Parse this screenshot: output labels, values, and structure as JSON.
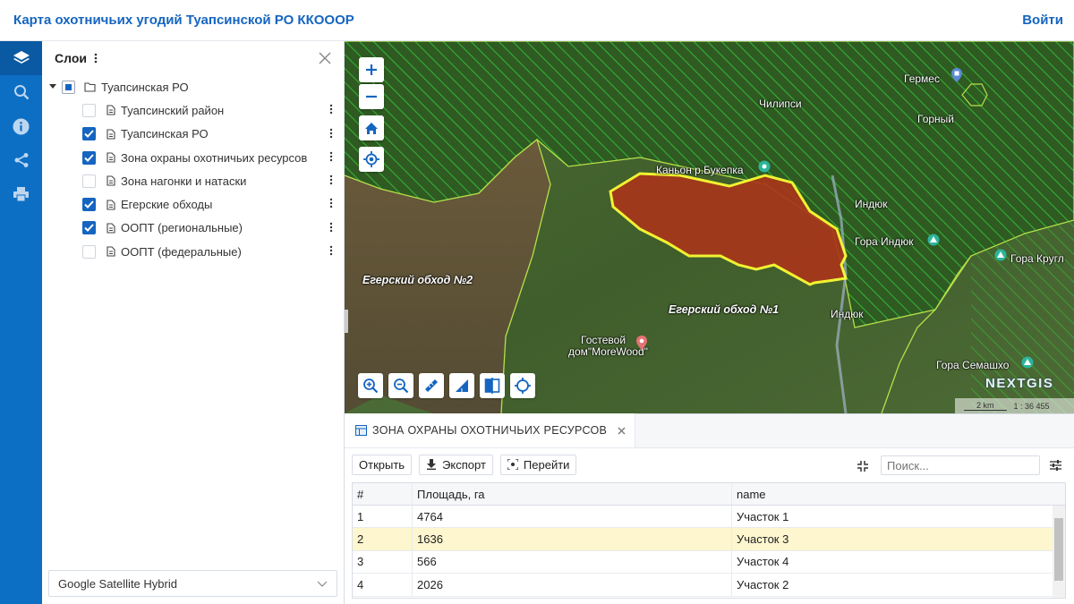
{
  "header": {
    "title": "Карта охотничьих угодий Туапсинской РО ККОООР",
    "login": "Войти"
  },
  "rail": {
    "items": [
      "layers-icon",
      "search-icon",
      "info-icon",
      "share-icon",
      "print-icon"
    ]
  },
  "panel": {
    "title": "Слои",
    "tree_root": "Туапсинская РО",
    "layers": [
      {
        "label": "Туапсинский район",
        "checked": false
      },
      {
        "label": "Туапсинская РО",
        "checked": true
      },
      {
        "label": "Зона охраны охотничьих ресурсов",
        "checked": true
      },
      {
        "label": "Зона нагонки и натаски",
        "checked": false
      },
      {
        "label": "Егерские обходы",
        "checked": true
      },
      {
        "label": "ООПТ (региональные)",
        "checked": true
      },
      {
        "label": "ООПТ (федеральные)",
        "checked": false
      }
    ],
    "basemap": "Google Satellite Hybrid"
  },
  "map": {
    "labels": {
      "germes": "Гермес",
      "chilipsi": "Чилипси",
      "gorny": "Горный",
      "kanyon": "Каньон р.Букепка",
      "induk1": "Индюк",
      "gora_induk": "Гора Индюк",
      "gora_krugl": "Гора Кругл",
      "obkhod2": "Егерский обход №2",
      "obkhod1": "Егерский обход №1",
      "induk2": "Индюк",
      "guest": "Гостевой",
      "guest2": "дом\"MoreWood\"",
      "gora_semashko": "Гора Семашхо",
      "logo": "NEXTGIS",
      "scale": "2 km",
      "scale_ratio": "1 : 36 455"
    },
    "colors": {
      "protection_zone": "#b33a1f",
      "outline": "#ffff33",
      "hatch": "#3fd13f"
    }
  },
  "attributes": {
    "tab_label": "ЗОНА ОХРАНЫ ОХОТНИЧЬИХ РЕСУРСОВ",
    "toolbar": {
      "open": "Открыть",
      "export": "Экспорт",
      "goto": "Перейти",
      "search_placeholder": "Поиск..."
    },
    "columns": [
      "#",
      "Площадь, га",
      "name"
    ],
    "rows": [
      [
        "1",
        "4764",
        "Участок 1"
      ],
      [
        "2",
        "1636",
        "Участок 3"
      ],
      [
        "3",
        "566",
        "Участок 4"
      ],
      [
        "4",
        "2026",
        "Участок 2"
      ]
    ],
    "selected_row": 2
  }
}
